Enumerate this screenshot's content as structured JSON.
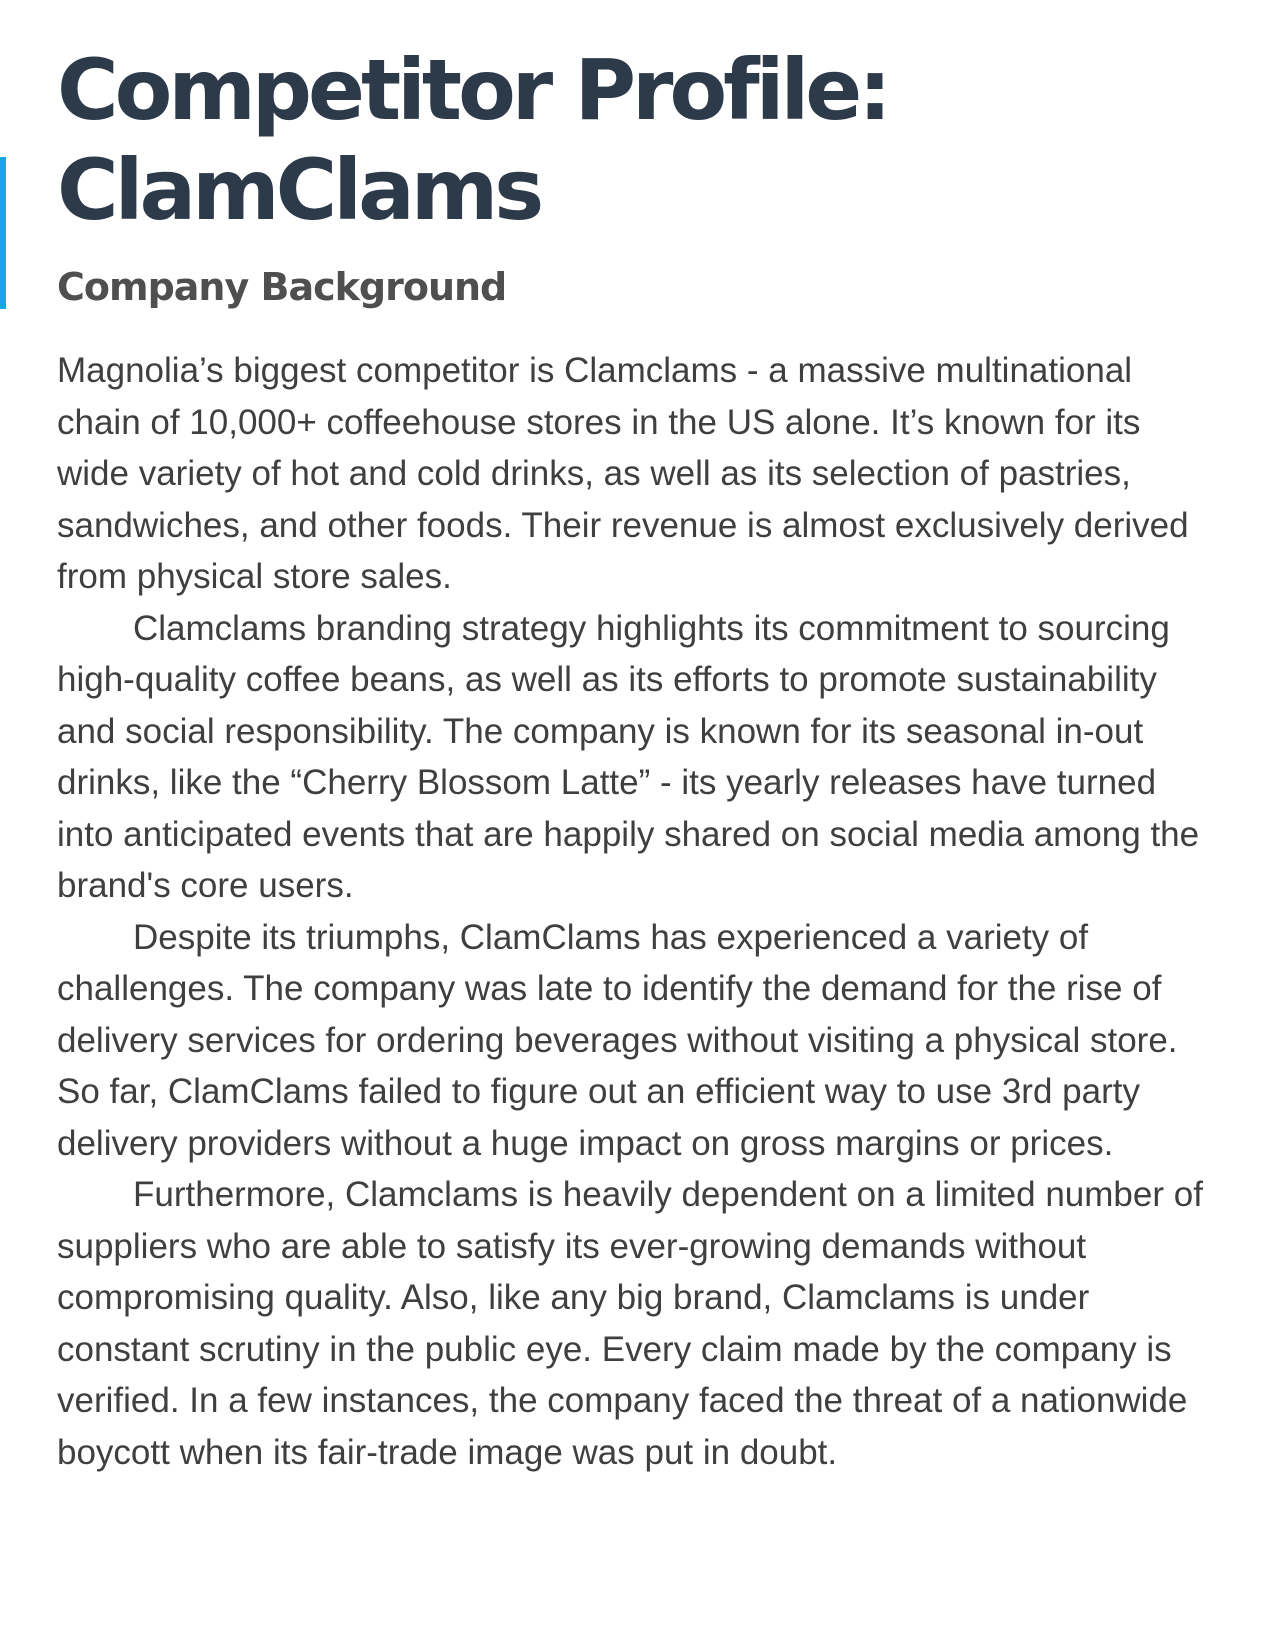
{
  "title": {
    "line1": "Competitor Profile:",
    "line2": "ClamClams"
  },
  "section": {
    "heading": "Company Background"
  },
  "paragraphs": [
    "Magnolia’s biggest competitor is Clamclams - a massive multinational chain of 10,000+ coffeehouse stores in the US alone. It’s known for its wide variety of hot and cold drinks, as well as its selection of pastries, sandwiches, and other foods. Their revenue is almost exclusively derived from physical store sales.",
    "Clamclams branding strategy highlights its commitment to sourcing high-quality coffee beans, as well as its efforts to promote sustainability and social responsibility. The company is known for its seasonal in-out drinks, like the “Cherry Blossom Latte” - its yearly releases have turned into anticipated events that are happily shared on social media among the brand's core users.",
    "Despite its triumphs, ClamClams has experienced a variety of challenges. The company was late to identify the demand for the rise of delivery services for ordering beverages without visiting a physical store. So far, ClamClams failed to figure out an efficient way to use 3rd party delivery providers without a huge impact on gross margins or prices.",
    "Furthermore, Clamclams is heavily dependent on a limited number of suppliers who are able to satisfy its ever-growing demands without compromising quality. Also, like any big brand, Clamclams is under constant scrutiny in the public eye. Every claim made by the company is verified. In a few instances, the company faced the threat of a nationwide boycott when its fair-trade image was put in doubt."
  ],
  "colors": {
    "accent": "#1aa7df",
    "title": "#2d3a4a",
    "heading": "#4f4f4f",
    "body": "#3f3f3f"
  }
}
